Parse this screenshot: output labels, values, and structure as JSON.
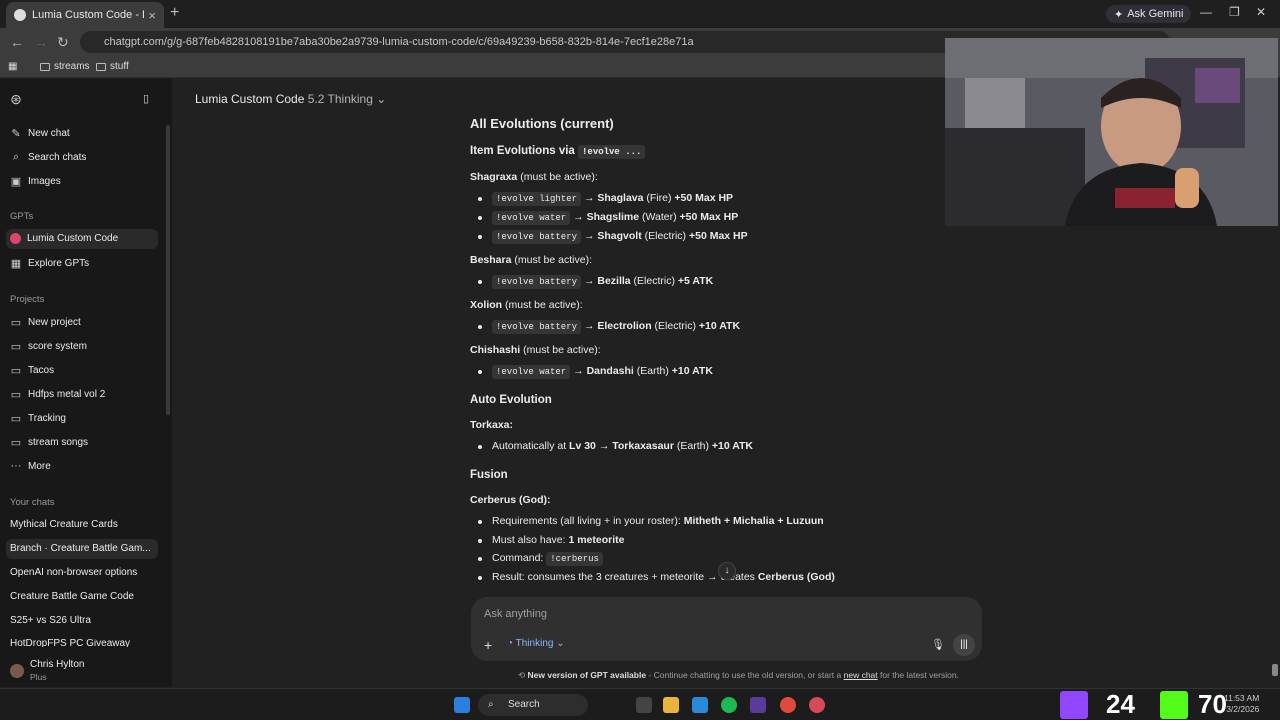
{
  "browser": {
    "tab_title": "Lumia Custom Code - Branch",
    "url": "chatgpt.com/g/g-687feb4828108191be7aba30be2a9739-lumia-custom-code/c/69a49239-b658-832b-814e-7ecf1e28e71a",
    "ask_gemini": "Ask Gemini",
    "bookmarks": [
      "streams",
      "stuff"
    ]
  },
  "sidebar": {
    "new_chat": "New chat",
    "search_chats": "Search chats",
    "images": "Images",
    "gpts_heading": "GPTs",
    "gpts": [
      "Lumia Custom Code",
      "Explore GPTs"
    ],
    "projects_heading": "Projects",
    "projects": [
      "New project",
      "score system",
      "Tacos",
      "Hdfps metal vol 2",
      "Tracking",
      "stream songs",
      "More"
    ],
    "chats_heading": "Your chats",
    "chats": [
      "Mythical Creature Cards",
      "Branch · Creature Battle Gam...",
      "OpenAI non-browser options",
      "Creature Battle Game Code",
      "S25+ vs S26 Ultra",
      "HotDropFPS PC Giveaway"
    ],
    "user_name": "Chris Hylton",
    "user_plan": "Plus"
  },
  "header": {
    "title": "Lumia Custom Code",
    "model": "5.2 Thinking"
  },
  "content": {
    "h_all": "All Evolutions (current)",
    "h_item": "Item Evolutions via",
    "h_item_code": "!evolve ...",
    "shagraxa": "Shagraxa",
    "must_active": "(must be active):",
    "shag1_code": "!evolve lighter",
    "shag1_name": "Shaglava",
    "shag1_type": "(Fire)",
    "shag1_bonus": "+50 Max HP",
    "shag2_code": "!evolve water",
    "shag2_name": "Shagslime",
    "shag2_type": "(Water)",
    "shag2_bonus": "+50 Max HP",
    "shag3_code": "!evolve battery",
    "shag3_name": "Shagvolt",
    "shag3_type": "(Electric)",
    "shag3_bonus": "+50 Max HP",
    "beshara": "Beshara",
    "besh_code": "!evolve battery",
    "besh_name": "Bezilla",
    "besh_type": "(Electric)",
    "besh_bonus": "+5 ATK",
    "xolion": "Xolion",
    "xol_code": "!evolve battery",
    "xol_name": "Electrolion",
    "xol_type": "(Electric)",
    "xol_bonus": "+10 ATK",
    "chishashi": "Chishashi",
    "chi_code": "!evolve water",
    "chi_name": "Dandashi",
    "chi_type": "(Earth)",
    "chi_bonus": "+10 ATK",
    "arrow": "→",
    "h_auto": "Auto Evolution",
    "torkaxa": "Torkaxa:",
    "tork_text": "Automatically at",
    "tork_lv": "Lv 30",
    "tork_name": "Torkaxasaur",
    "tork_type": "(Earth)",
    "tork_bonus": "+10 ATK",
    "h_fusion": "Fusion",
    "cerberus_h": "Cerberus (God):",
    "req_label": "Requirements (all living + in your roster):",
    "req_value": "Mitheth + Michalia + Luzuun",
    "also_label": "Must also have:",
    "also_value": "1 meteorite",
    "cmd_label": "Command:",
    "cmd_code": "!cerberus",
    "result_label": "Result: consumes the 3 creatures + meteorite →",
    "result_tail": "creates",
    "result_value": "Cerberus (God)"
  },
  "composer": {
    "placeholder": "Ask anything",
    "mode": "Thinking"
  },
  "notice": {
    "bold": "New version of GPT available",
    "text": "- Continue chatting to use the old version, or start a",
    "link": "new chat",
    "tail": "for the latest version."
  },
  "taskbar": {
    "search": "Search",
    "counter_left": "24",
    "counter_right": "70",
    "time": "11:53 AM",
    "date": "3/2/2026"
  }
}
